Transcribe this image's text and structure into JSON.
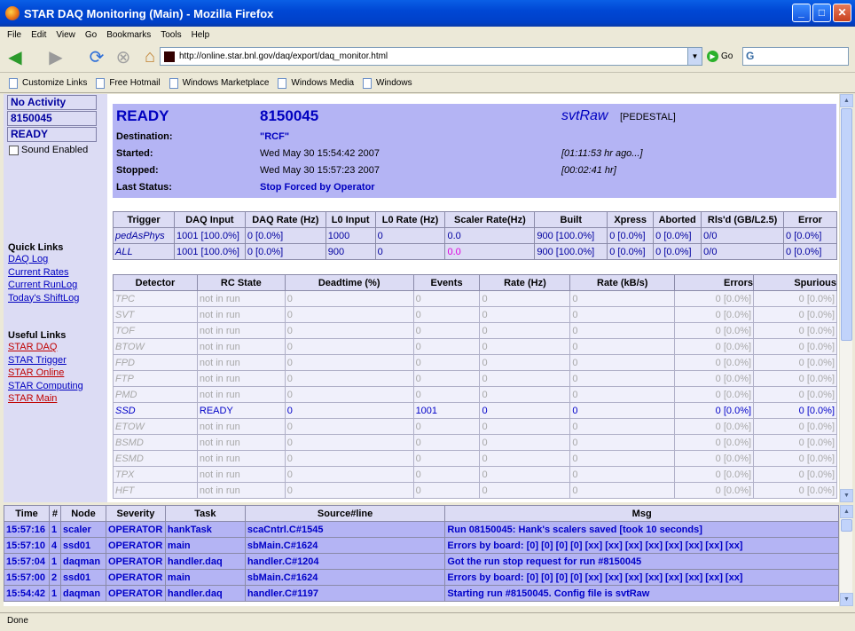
{
  "window": {
    "title": "STAR DAQ Monitoring (Main) - Mozilla Firefox"
  },
  "menu": [
    "File",
    "Edit",
    "View",
    "Go",
    "Bookmarks",
    "Tools",
    "Help"
  ],
  "nav": {
    "url": "http://online.star.bnl.gov/daq/export/daq_monitor.html",
    "go_label": "Go",
    "search_logo": "G"
  },
  "bookmarks": [
    "Customize Links",
    "Free Hotmail",
    "Windows Marketplace",
    "Windows Media",
    "Windows"
  ],
  "sidebar": {
    "status_boxes": [
      "No Activity",
      "8150045",
      "READY"
    ],
    "sound_label": "Sound Enabled",
    "quick_heading": "Quick Links",
    "quick_links": [
      "DAQ Log",
      "Current Rates",
      "Current RunLog",
      "Today's ShiftLog"
    ],
    "useful_heading": "Useful Links",
    "useful_links": [
      {
        "label": "STAR DAQ",
        "color": "#c00000"
      },
      {
        "label": "STAR Trigger",
        "color": "#0000c0"
      },
      {
        "label": "STAR Online",
        "color": "#c00000"
      },
      {
        "label": "STAR Computing",
        "color": "#0000c0"
      },
      {
        "label": "STAR Main",
        "color": "#c00000"
      }
    ]
  },
  "run": {
    "state": "READY",
    "number": "8150045",
    "config": "svtRaw",
    "config_type": "[PEDESTAL]",
    "destination_label": "Destination:",
    "destination": "\"RCF\"",
    "started_label": "Started:",
    "started": "Wed May 30 15:54:42 2007",
    "started_ago": "[01:11:53 hr ago...]",
    "stopped_label": "Stopped:",
    "stopped": "Wed May 30 15:57:23 2007",
    "stopped_dur": "[00:02:41 hr]",
    "status_label": "Last Status:",
    "status": "Stop Forced by Operator"
  },
  "triggers": {
    "headers": [
      "Trigger",
      "DAQ Input",
      "DAQ Rate (Hz)",
      "L0 Input",
      "L0 Rate (Hz)",
      "Scaler Rate(Hz)",
      "Built",
      "Xpress",
      "Aborted",
      "Rls'd (GB/L2.5)",
      "Error"
    ],
    "rows": [
      [
        "pedAsPhys",
        "1001 [100.0%]",
        "0 [0.0%]",
        "1000",
        "0",
        "0.0",
        "900 [100.0%]",
        "0 [0.0%]",
        "0 [0.0%]",
        "0/0",
        "0 [0.0%]"
      ],
      [
        "ALL",
        "1001 [100.0%]",
        "0 [0.0%]",
        "900",
        "0",
        "0.0",
        "900 [100.0%]",
        "0 [0.0%]",
        "0 [0.0%]",
        "0/0",
        "0 [0.0%]"
      ]
    ],
    "highlight_color": "#e000e0"
  },
  "detectors": {
    "headers": [
      "Detector",
      "RC State",
      "Deadtime (%)",
      "Events",
      "Rate (Hz)",
      "Rate (kB/s)",
      "Errors",
      "Spurious"
    ],
    "rows": [
      {
        "active": false,
        "cells": [
          "TPC",
          "not in run",
          "0",
          "0",
          "0",
          "0",
          "0 [0.0%]",
          "0 [0.0%]"
        ]
      },
      {
        "active": false,
        "cells": [
          "SVT",
          "not in run",
          "0",
          "0",
          "0",
          "0",
          "0 [0.0%]",
          "0 [0.0%]"
        ]
      },
      {
        "active": false,
        "cells": [
          "TOF",
          "not in run",
          "0",
          "0",
          "0",
          "0",
          "0 [0.0%]",
          "0 [0.0%]"
        ]
      },
      {
        "active": false,
        "cells": [
          "BTOW",
          "not in run",
          "0",
          "0",
          "0",
          "0",
          "0 [0.0%]",
          "0 [0.0%]"
        ]
      },
      {
        "active": false,
        "cells": [
          "FPD",
          "not in run",
          "0",
          "0",
          "0",
          "0",
          "0 [0.0%]",
          "0 [0.0%]"
        ]
      },
      {
        "active": false,
        "cells": [
          "FTP",
          "not in run",
          "0",
          "0",
          "0",
          "0",
          "0 [0.0%]",
          "0 [0.0%]"
        ]
      },
      {
        "active": false,
        "cells": [
          "PMD",
          "not in run",
          "0",
          "0",
          "0",
          "0",
          "0 [0.0%]",
          "0 [0.0%]"
        ]
      },
      {
        "active": true,
        "cells": [
          "SSD",
          "READY",
          "0",
          "1001",
          "0",
          "0",
          "0 [0.0%]",
          "0 [0.0%]"
        ]
      },
      {
        "active": false,
        "cells": [
          "ETOW",
          "not in run",
          "0",
          "0",
          "0",
          "0",
          "0 [0.0%]",
          "0 [0.0%]"
        ]
      },
      {
        "active": false,
        "cells": [
          "BSMD",
          "not in run",
          "0",
          "0",
          "0",
          "0",
          "0 [0.0%]",
          "0 [0.0%]"
        ]
      },
      {
        "active": false,
        "cells": [
          "ESMD",
          "not in run",
          "0",
          "0",
          "0",
          "0",
          "0 [0.0%]",
          "0 [0.0%]"
        ]
      },
      {
        "active": false,
        "cells": [
          "TPX",
          "not in run",
          "0",
          "0",
          "0",
          "0",
          "0 [0.0%]",
          "0 [0.0%]"
        ]
      },
      {
        "active": false,
        "cells": [
          "HFT",
          "not in run",
          "0",
          "0",
          "0",
          "0",
          "0 [0.0%]",
          "0 [0.0%]"
        ]
      }
    ]
  },
  "log": {
    "headers": [
      "Time",
      "#",
      "Node",
      "Severity",
      "Task",
      "Source#line",
      "Msg"
    ],
    "rows": [
      [
        "15:57:16",
        "1",
        "scaler",
        "OPERATOR",
        "hankTask",
        "scaCntrl.C#1545",
        "Run 08150045: Hank's scalers saved [took 10 seconds]"
      ],
      [
        "15:57:10",
        "4",
        "ssd01",
        "OPERATOR",
        "main",
        "sbMain.C#1624",
        "Errors by board: [0] [0] [0] [0] [xx] [xx] [xx] [xx] [xx] [xx] [xx] [xx]"
      ],
      [
        "15:57:04",
        "1",
        "daqman",
        "OPERATOR",
        "handler.daq",
        "handler.C#1204",
        "Got the run stop request for run #8150045"
      ],
      [
        "15:57:00",
        "2",
        "ssd01",
        "OPERATOR",
        "main",
        "sbMain.C#1624",
        "Errors by board: [0] [0] [0] [0] [xx] [xx] [xx] [xx] [xx] [xx] [xx] [xx]"
      ],
      [
        "15:54:42",
        "1",
        "daqman",
        "OPERATOR",
        "handler.daq",
        "handler.C#1197",
        "Starting run #8150045. Config file is svtRaw"
      ]
    ]
  },
  "status_bar": "Done"
}
